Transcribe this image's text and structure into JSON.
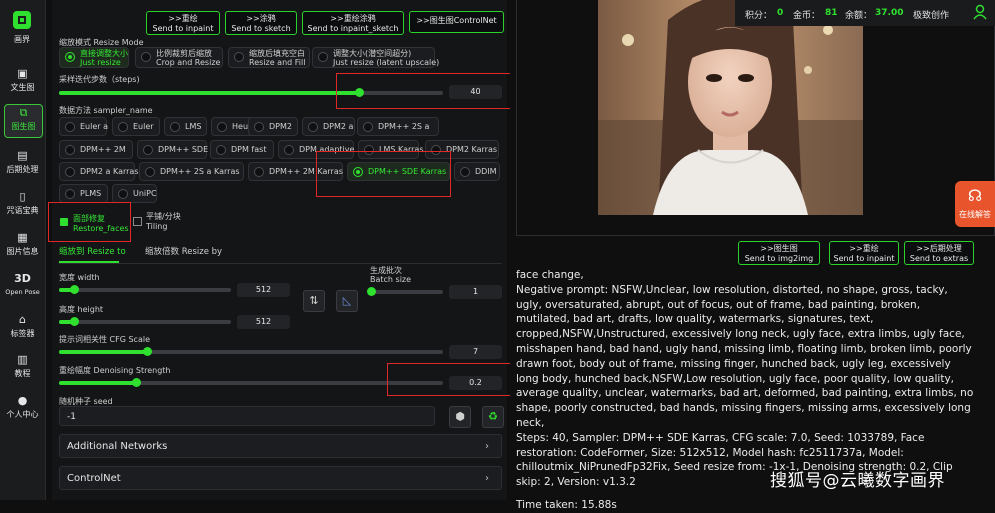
{
  "nav": {
    "logo_label": "画界",
    "items": [
      {
        "label": "文生图"
      },
      {
        "label": "图生图"
      },
      {
        "label": "后期处理"
      },
      {
        "label": "咒语宝典"
      },
      {
        "label": "图片信息"
      },
      {
        "label": "Open Pose",
        "icon_text": "3D"
      },
      {
        "label": "标签器"
      },
      {
        "label": "教程"
      },
      {
        "label": "个人中心"
      }
    ]
  },
  "top_buttons": [
    {
      "cn": ">>重绘",
      "en": "Send to inpaint"
    },
    {
      "cn": ">>涂鸦",
      "en": "Send to sketch"
    },
    {
      "cn": ">>重绘涂鸦",
      "en": "Send to inpaint_sketch"
    },
    {
      "cn": ">>图生图ControlNet",
      "en": ""
    }
  ],
  "resize_mode": {
    "label": "缩放模式 Resize Mode",
    "options": [
      {
        "cn": "直接调整大小",
        "en": "Just resize",
        "selected": true
      },
      {
        "cn": "比例裁剪后缩放",
        "en": "Crop and Resize",
        "selected": false
      },
      {
        "cn": "缩放后填充空白",
        "en": "Resize and Fill",
        "selected": false
      },
      {
        "cn": "调整大小(潜空间超分)",
        "en": "Just resize (latent upscale)",
        "selected": false
      }
    ]
  },
  "steps": {
    "label": "采样迭代步数（steps)",
    "value": "40",
    "fraction": 0.78
  },
  "sampler": {
    "label": "数据方法 sampler_name",
    "options": [
      "Euler a",
      "Euler",
      "LMS",
      "Heun",
      "DPM2",
      "DPM2 a",
      "DPM++ 2S a",
      "DPM++ 2M",
      "DPM++ SDE",
      "DPM fast",
      "DPM adaptive",
      "LMS Karras",
      "DPM2 Karras",
      "DPM2 a Karras",
      "DPM++ 2S a Karras",
      "DPM++ 2M Karras",
      "DPM++ SDE Karras",
      "DDIM",
      "PLMS",
      "UniPC"
    ],
    "selected": "DPM++ SDE Karras"
  },
  "restore_faces": {
    "cn": "面部修复",
    "en": "Restore_faces",
    "checked": true
  },
  "tiling": {
    "cn": "平铺/分块",
    "en": "Tiling",
    "checked": false
  },
  "resize_tabs": [
    {
      "label": "缩放到 Resize to",
      "active": true
    },
    {
      "label": "缩放倍数 Resize by",
      "active": false
    }
  ],
  "width": {
    "label": "宽度 width",
    "value": "512",
    "fraction": 0.09
  },
  "height": {
    "label": "高度 height",
    "value": "512",
    "fraction": 0.09
  },
  "batch_size": {
    "label_cn": "生成批次",
    "label_en": "Batch size",
    "value": "1",
    "fraction": 0.02
  },
  "cfg": {
    "label": "提示词相关性 CFG Scale",
    "value": "7",
    "fraction": 0.23
  },
  "denoise": {
    "label": "重绘幅度 Denoising Strength",
    "value": "0.2",
    "fraction": 0.2
  },
  "seed": {
    "label": "随机种子 seed",
    "value": "-1"
  },
  "accordions": [
    {
      "label": "Additional Networks"
    },
    {
      "label": "ControlNet"
    }
  ],
  "topbar": {
    "points_label": "积分：",
    "points_value": "0",
    "coins_label": "金币：",
    "coins_value": "81",
    "balance_label": "余额：",
    "balance_value": "37.00",
    "mode": "极致创作"
  },
  "output_buttons": [
    {
      "cn": ">>图生图",
      "en": "Send to img2img"
    },
    {
      "cn": ">>重绘",
      "en": "Send to inpaint"
    },
    {
      "cn": ">>后期处理",
      "en": "Send to extras"
    }
  ],
  "help": {
    "label": "在线解答"
  },
  "info_text": {
    "prompt_tail": "face change,",
    "negative": "Negative prompt: NSFW,Unclear, low resolution, distorted, no shape, gross, tacky, ugly, oversaturated, abrupt, out of focus, out of frame, bad painting, broken, mutilated, bad art, drafts, low quality, watermarks, signatures, text, cropped,NSFW,Unstructured, excessively long neck, ugly face, extra limbs, ugly face, misshapen hand, bad hand, ugly hand, missing limb, floating limb, broken limb, poorly drawn foot, body out of frame, missing finger, hunched back, ugly leg, excessively long body, hunched back,NSFW,Low resolution, ugly face, poor quality, low quality, average quality, unclear, watermarks, bad art, deformed, bad painting, extra limbs, no shape, poorly constructed, bad hands, missing fingers, missing arms, excessively long neck,",
    "params": "Steps: 40, Sampler: DPM++ SDE Karras, CFG scale: 7.0, Seed: 1033789, Face restoration: CodeFormer, Size: 512x512, Model hash: fc2511737a, Model: chilloutmix_NiPrunedFp32Fix, Seed resize from: -1x-1, Denoising strength: 0.2, Clip skip: 2, Version: v1.3.2",
    "time": "Time taken: 15.88s"
  },
  "watermark": "搜狐号@云曦数字画界",
  "colors": {
    "accent": "#2fe02f",
    "highlight": "#e02828",
    "panel": "#141517"
  }
}
